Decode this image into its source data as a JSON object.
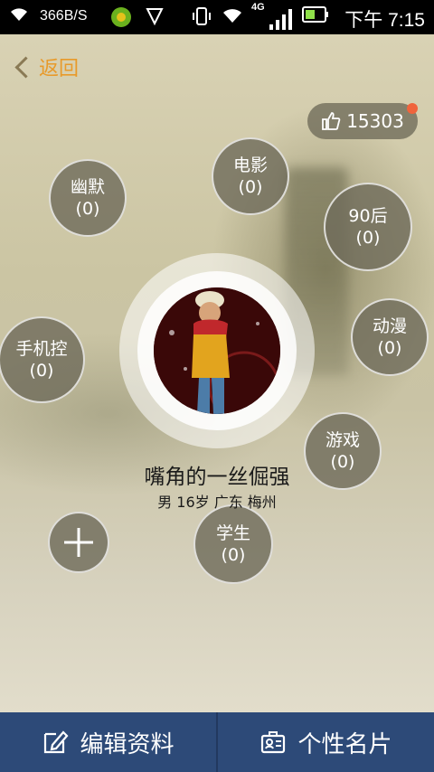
{
  "status_bar": {
    "net_speed": "366B/S",
    "network": "4G",
    "time": "下午 7:15",
    "icons": [
      "wifi-icon",
      "app-icon",
      "shield-icon",
      "vibrate-icon",
      "wifi-signal-icon",
      "cell-signal-icon",
      "battery-icon"
    ]
  },
  "header": {
    "back_label": "返回"
  },
  "likes": {
    "count": "15303"
  },
  "tags": [
    {
      "name": "幽默",
      "count": "(0)"
    },
    {
      "name": "电影",
      "count": "(0)"
    },
    {
      "name": "90后",
      "count": "(0)"
    },
    {
      "name": "手机控",
      "count": "(0)"
    },
    {
      "name": "动漫",
      "count": "(0)"
    },
    {
      "name": "游戏",
      "count": "(0)"
    },
    {
      "name": "学生",
      "count": "(0)"
    }
  ],
  "profile": {
    "nickname": "嘴角的一丝倔强",
    "details": "男 16岁 广东 梅州"
  },
  "bottom_bar": {
    "edit_label": "编辑资料",
    "card_label": "个性名片"
  },
  "colors": {
    "accent": "#e89a2a",
    "bottom_bar": "#2d4a78",
    "like_dot": "#f0643c"
  }
}
